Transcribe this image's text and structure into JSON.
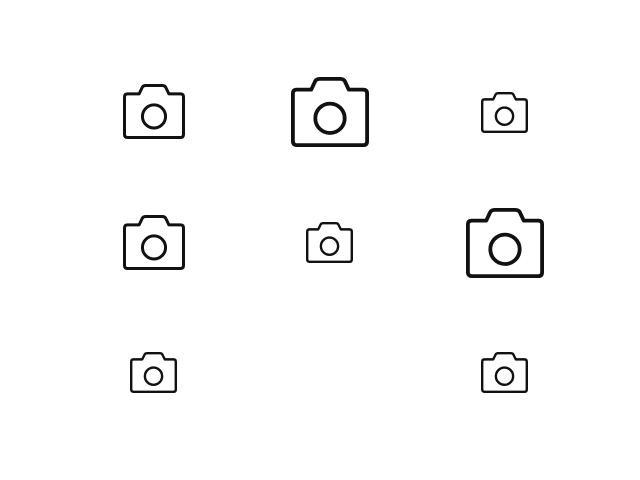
{
  "icons": [
    {
      "name": "camera-icon",
      "size": "medium"
    },
    {
      "name": "camera-icon",
      "size": "large"
    },
    {
      "name": "camera-icon",
      "size": "small"
    },
    {
      "name": "camera-icon",
      "size": "medium"
    },
    {
      "name": "camera-icon",
      "size": "small"
    },
    {
      "name": "camera-icon",
      "size": "large"
    },
    {
      "name": "camera-icon",
      "size": "small"
    },
    {
      "name": "camera-icon",
      "size": "small"
    }
  ],
  "colors": {
    "background": "#ffffff",
    "icon_stroke": "#111111"
  }
}
